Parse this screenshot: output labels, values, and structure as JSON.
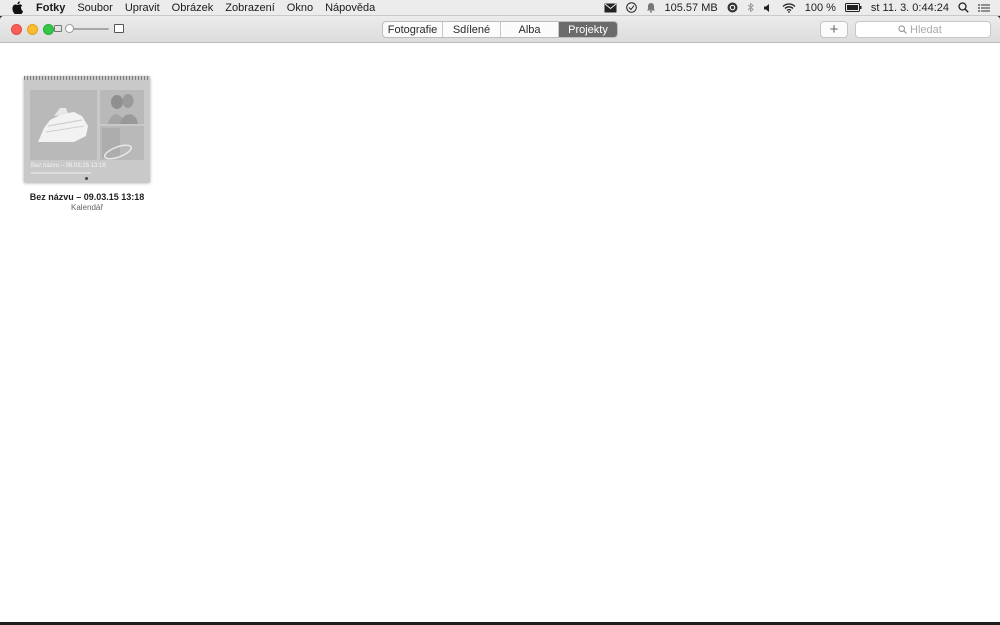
{
  "menubar": {
    "app_name": "Fotky",
    "items": [
      "Soubor",
      "Upravit",
      "Obrázek",
      "Zobrazení",
      "Okno",
      "Nápověda"
    ],
    "memory": "105.57 MB",
    "battery": "100 %",
    "datetime": "st 11. 3.  0:44:24"
  },
  "toolbar": {
    "tabs": [
      {
        "label": "Fotografie",
        "active": false
      },
      {
        "label": "Sdílené",
        "active": false
      },
      {
        "label": "Alba",
        "active": false
      },
      {
        "label": "Projekty",
        "active": true
      }
    ],
    "add_label": "+",
    "search_placeholder": "Hledat"
  },
  "projects": [
    {
      "thumb_title": "Bez názvu – 09.03.15 13:18",
      "name": "Bez názvu – 09.03.15 13:18",
      "type": "Kalendář"
    }
  ],
  "colors": {
    "close": "#fc5f57",
    "minimize": "#fdbc2e",
    "maximize": "#33c748",
    "active_tab": "#6b6b6b"
  }
}
